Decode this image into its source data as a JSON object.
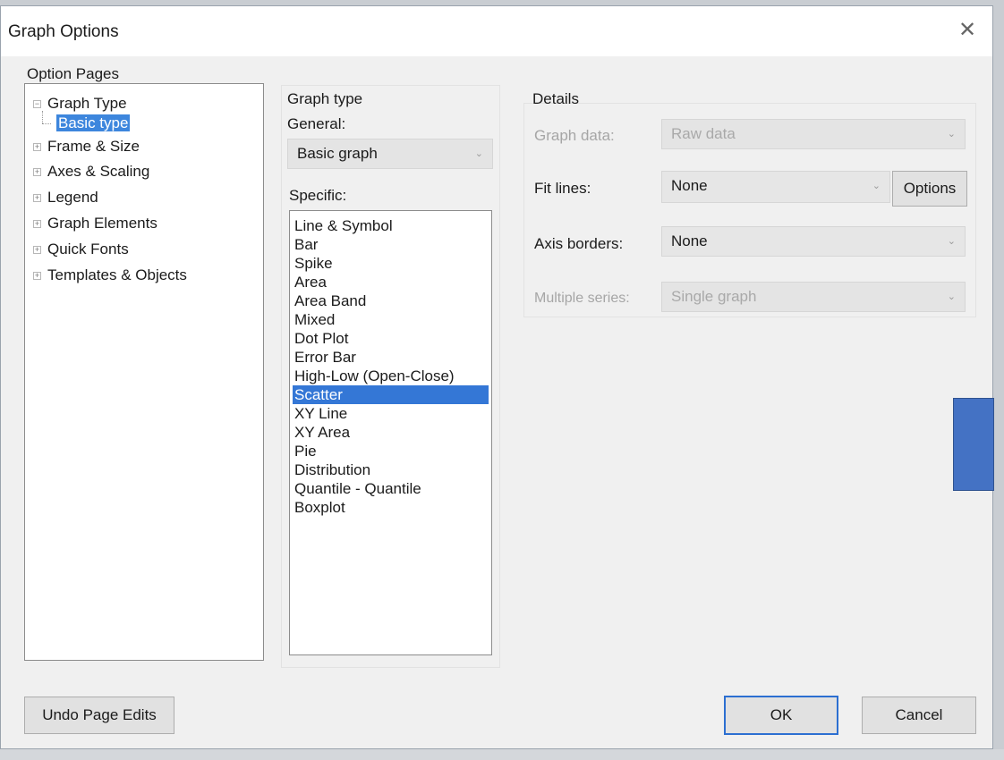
{
  "window": {
    "title": "Graph Options",
    "close_glyph": "✕"
  },
  "option_pages": {
    "label": "Option Pages",
    "items": [
      {
        "label": "Graph Type",
        "expander": "−"
      },
      {
        "label": "Basic type",
        "selected": true
      },
      {
        "label": "Frame & Size",
        "expander": "+"
      },
      {
        "label": "Axes & Scaling",
        "expander": "+"
      },
      {
        "label": "Legend",
        "expander": "+"
      },
      {
        "label": "Graph Elements",
        "expander": "+"
      },
      {
        "label": "Quick Fonts",
        "expander": "+"
      },
      {
        "label": "Templates & Objects",
        "expander": "+"
      }
    ]
  },
  "graph_type": {
    "heading": "Graph type",
    "general_label": "General:",
    "general_value": "Basic graph",
    "specific_label": "Specific:",
    "specific_items": [
      "Line & Symbol",
      "Bar",
      "Spike",
      "Area",
      "Area Band",
      "Mixed",
      "Dot Plot",
      "Error Bar",
      "High-Low (Open-Close)",
      "Scatter",
      "XY Line",
      "XY Area",
      "Pie",
      "Distribution",
      "Quantile - Quantile",
      "Boxplot"
    ],
    "selected_item": "Scatter"
  },
  "details": {
    "heading": "Details",
    "graph_data_label": "Graph data:",
    "graph_data_value": "Raw data",
    "fit_lines_label": "Fit lines:",
    "fit_lines_value": "None",
    "options_button": "Options",
    "axis_borders_label": "Axis borders:",
    "axis_borders_value": "None",
    "multiple_series_label": "Multiple series:",
    "multiple_series_value": "Single graph"
  },
  "footer": {
    "undo_button": "Undo Page Edits",
    "ok_button": "OK",
    "cancel_button": "Cancel"
  },
  "colors": {
    "selection": "#3477d6",
    "overlay_rect": "#4472c4"
  },
  "icons": {
    "dropdown": "chevron-down-icon",
    "close": "close-icon"
  }
}
